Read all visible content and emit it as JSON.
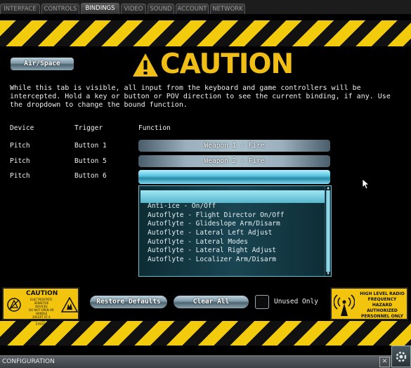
{
  "tabs": [
    {
      "label": "INTERFACE"
    },
    {
      "label": "CONTROLS"
    },
    {
      "label": "BINDINGS"
    },
    {
      "label": "VIDEO"
    },
    {
      "label": "SOUND"
    },
    {
      "label": "ACCOUNT"
    },
    {
      "label": "NETWORK"
    }
  ],
  "active_tab": "BINDINGS",
  "mode_button": "Air/Space",
  "banner": {
    "title": "CAUTION",
    "icon": "warning-triangle-icon"
  },
  "intro": "While this tab is visible, all input from the keyboard and game controllers will be intercepted. Hold a key or button or POV direction to see the current binding, if any. Use the dropdown to change the bound function.",
  "columns": {
    "device": "Device",
    "trigger": "Trigger",
    "function": "Function"
  },
  "bindings": [
    {
      "device": "Pitch",
      "trigger": "Button 1",
      "function": "Weapon 1 - Fire"
    },
    {
      "device": "Pitch",
      "trigger": "Button 5",
      "function": "Weapon 2 - Fire"
    },
    {
      "device": "Pitch",
      "trigger": "Button 6",
      "function": ""
    }
  ],
  "dropdown_options": [
    "Anti-ice - On/Off",
    "Autoflyte - Flight Director On/Off",
    "Autoflyte - Glideslope Arm/Disarm",
    "Autoflyte - Lateral Left Adjust",
    "Autoflyte - Lateral Modes",
    "Autoflyte - Lateral Right Adjust",
    "Autoflyte - Localizer Arm/Disarm"
  ],
  "buttons": {
    "restore": "Restore Defaults",
    "clear": "Clear All"
  },
  "unused_only": {
    "label": "Unused Only",
    "checked": false
  },
  "left_sign": {
    "title": "CAUTION",
    "lines": [
      "ELECTROSTATIC",
      "SENSITIVE",
      "DEVICES",
      "DO NOT OPEN OR HANDLE",
      "EXCEPT AT A",
      "STATIC-FREE WORK STATION"
    ]
  },
  "right_sign": {
    "lines": [
      "HIGH LEVEL RADIO",
      "FREQUENCY",
      "HAZARD",
      "AUTHORIZED",
      "PERSONNEL ONLY"
    ]
  },
  "status": {
    "title": "CONFIGURATION",
    "close": "✕"
  },
  "colors": {
    "hazard_yellow": "#f2cb0c",
    "caution_text": "#f0be14",
    "dropdown_bg": "#1a4552"
  }
}
